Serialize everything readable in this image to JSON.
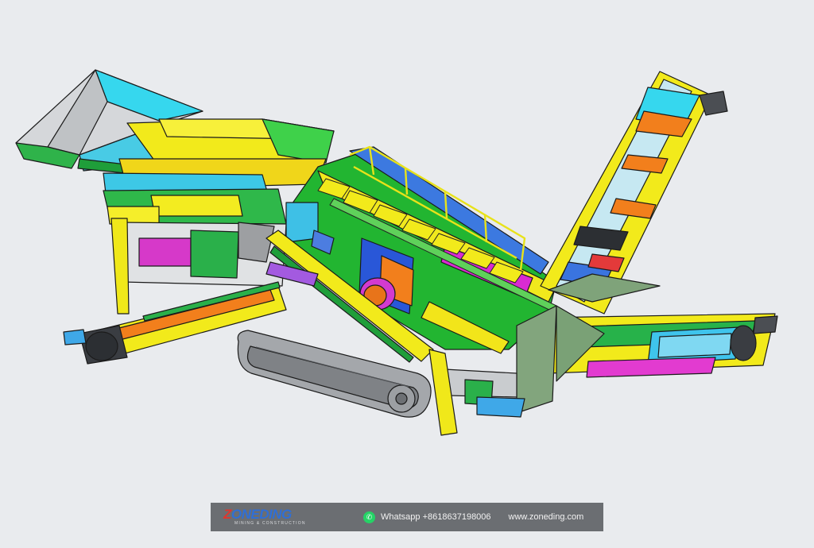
{
  "footer": {
    "logo_brand_lead": "Z",
    "logo_brand_rest": "ONEDING",
    "logo_tagline": "MINING & CONSTRUCTION",
    "whatsapp_text": "Whatsapp +8618637198006",
    "website_text": "www.zoneding.com"
  },
  "icons": {
    "whatsapp": "whatsapp-icon",
    "logo": "zoneding-logo"
  },
  "colors": {
    "background": "#e9ebee",
    "footer_bar": "#6b6e72",
    "brand_blue": "#2f6fd6",
    "brand_red": "#e0362c",
    "whatsapp_green": "#25d366"
  }
}
